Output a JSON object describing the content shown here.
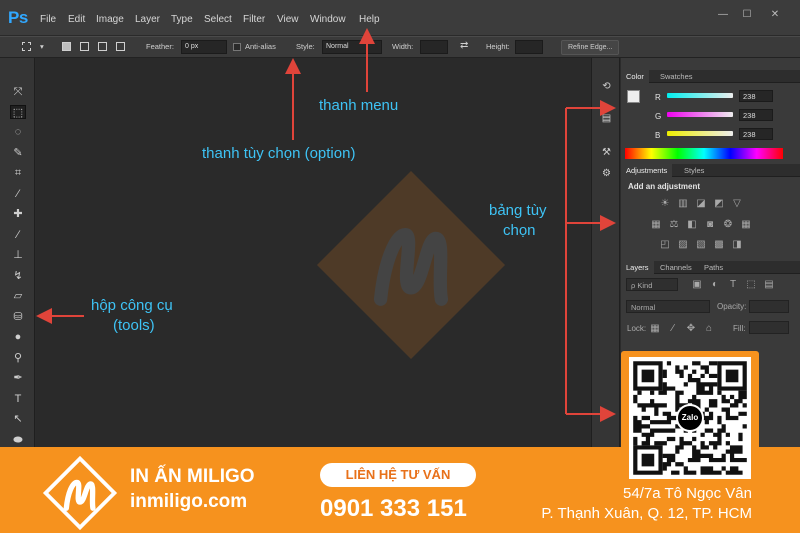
{
  "app": {
    "logo": "Ps",
    "menu": [
      "File",
      "Edit",
      "Image",
      "Layer",
      "Type",
      "Select",
      "Filter",
      "View",
      "Window",
      "Help"
    ],
    "window_controls": [
      "—",
      "☐",
      "✕"
    ]
  },
  "options": {
    "feather_label": "Feather:",
    "feather_value": "0 px",
    "antialias_label": "Anti-alias",
    "style_label": "Style:",
    "style_value": "Normal",
    "width_label": "Width:",
    "height_label": "Height:",
    "refine_edge": "Refine Edge..."
  },
  "panels": {
    "color": {
      "tabs": [
        "Color",
        "Swatches"
      ],
      "channels": [
        {
          "label": "R",
          "value": "238",
          "color": "#e05050"
        },
        {
          "label": "G",
          "value": "238",
          "color": "#50c050"
        },
        {
          "label": "B",
          "value": "238",
          "color": "#5080e0"
        }
      ]
    },
    "adjustments": {
      "tabs": [
        "Adjustments",
        "Styles"
      ],
      "heading": "Add an adjustment"
    },
    "layers": {
      "tabs": [
        "Layers",
        "Channels",
        "Paths"
      ],
      "kind_label": "ρ Kind",
      "blend_mode": "Normal",
      "opacity_label": "Opacity:",
      "lock_label": "Lock:",
      "fill_label": "Fill:"
    }
  },
  "annotations": {
    "menu": "thanh menu",
    "options": "thanh tùy chọn (option)",
    "panels_line1": "bảng tùy",
    "panels_line2": "chọn",
    "tools_line1": "hộp công cụ",
    "tools_line2": "(tools)"
  },
  "qr": {
    "badge": "Zalo"
  },
  "banner": {
    "brand": "IN ẤN MILIGO",
    "url": "inmiligo.com",
    "contact_label": "LIÊN HỆ TƯ VẤN",
    "phone": "0901 333 151",
    "address_line1": "54/7a Tô Ngọc Vân",
    "address_line2": "P. Thạnh Xuân, Q. 12, TP. HCM"
  },
  "colors": {
    "accent": "#31a8ff",
    "annotation": "#3ec3f5",
    "banner": "#f6921e",
    "arrow": "#e0443a"
  }
}
